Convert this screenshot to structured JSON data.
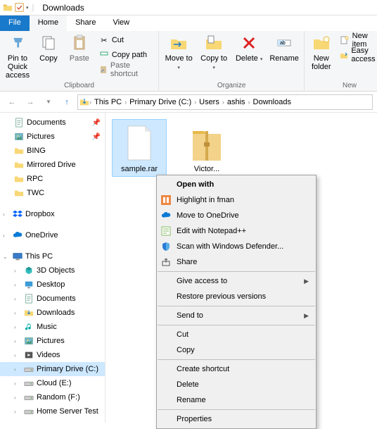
{
  "window": {
    "title": "Downloads"
  },
  "tabs": {
    "file": "File",
    "home": "Home",
    "share": "Share",
    "view": "View"
  },
  "ribbon": {
    "clipboard": {
      "label": "Clipboard",
      "pin": "Pin to Quick access",
      "copy": "Copy",
      "paste": "Paste",
      "cut": "Cut",
      "copypath": "Copy path",
      "pasteshort": "Paste shortcut"
    },
    "organize": {
      "label": "Organize",
      "moveto": "Move to",
      "copyto": "Copy to",
      "delete": "Delete",
      "rename": "Rename"
    },
    "new": {
      "label": "New",
      "newfolder": "New folder",
      "newitem": "New item",
      "easyaccess": "Easy access"
    }
  },
  "breadcrumb": [
    "This PC",
    "Primary Drive (C:)",
    "Users",
    "ashis",
    "Downloads"
  ],
  "sidebar": {
    "quick": [
      {
        "label": "Documents",
        "pinned": true,
        "icon": "doc"
      },
      {
        "label": "Pictures",
        "pinned": true,
        "icon": "pic"
      },
      {
        "label": "BING",
        "pinned": false,
        "icon": "folder"
      },
      {
        "label": "Mirrored Drive",
        "pinned": false,
        "icon": "folder"
      },
      {
        "label": "RPC",
        "pinned": false,
        "icon": "folder"
      },
      {
        "label": "TWC",
        "pinned": false,
        "icon": "folder"
      }
    ],
    "dropbox": "Dropbox",
    "onedrive": "OneDrive",
    "thispc": {
      "label": "This PC",
      "items": [
        {
          "label": "3D Objects",
          "icon": "3d"
        },
        {
          "label": "Desktop",
          "icon": "desktop"
        },
        {
          "label": "Documents",
          "icon": "doc"
        },
        {
          "label": "Downloads",
          "icon": "down"
        },
        {
          "label": "Music",
          "icon": "music"
        },
        {
          "label": "Pictures",
          "icon": "pic"
        },
        {
          "label": "Videos",
          "icon": "video"
        },
        {
          "label": "Primary Drive (C:)",
          "icon": "drive",
          "selected": true
        },
        {
          "label": "Cloud (E:)",
          "icon": "drive"
        },
        {
          "label": "Random (F:)",
          "icon": "drive"
        },
        {
          "label": "Home Server Test",
          "icon": "drive"
        }
      ]
    }
  },
  "files": [
    {
      "name": "sample.rar",
      "type": "blank",
      "selected": true
    },
    {
      "name": "Victor...",
      "type": "zip",
      "selected": false
    }
  ],
  "context_menu": [
    {
      "label": "Open with",
      "bold": true,
      "icon": ""
    },
    {
      "label": "Highlight in fman",
      "icon": "fman"
    },
    {
      "label": "Move to OneDrive",
      "icon": "onedrive"
    },
    {
      "label": "Edit with Notepad++",
      "icon": "notepad"
    },
    {
      "label": "Scan with Windows Defender...",
      "icon": "defender"
    },
    {
      "label": "Share",
      "icon": "share"
    },
    {
      "sep": true
    },
    {
      "label": "Give access to",
      "submenu": true
    },
    {
      "label": "Restore previous versions"
    },
    {
      "sep": true
    },
    {
      "label": "Send to",
      "submenu": true
    },
    {
      "sep": true
    },
    {
      "label": "Cut"
    },
    {
      "label": "Copy"
    },
    {
      "sep": true
    },
    {
      "label": "Create shortcut"
    },
    {
      "label": "Delete"
    },
    {
      "label": "Rename"
    },
    {
      "sep": true
    },
    {
      "label": "Properties"
    }
  ]
}
